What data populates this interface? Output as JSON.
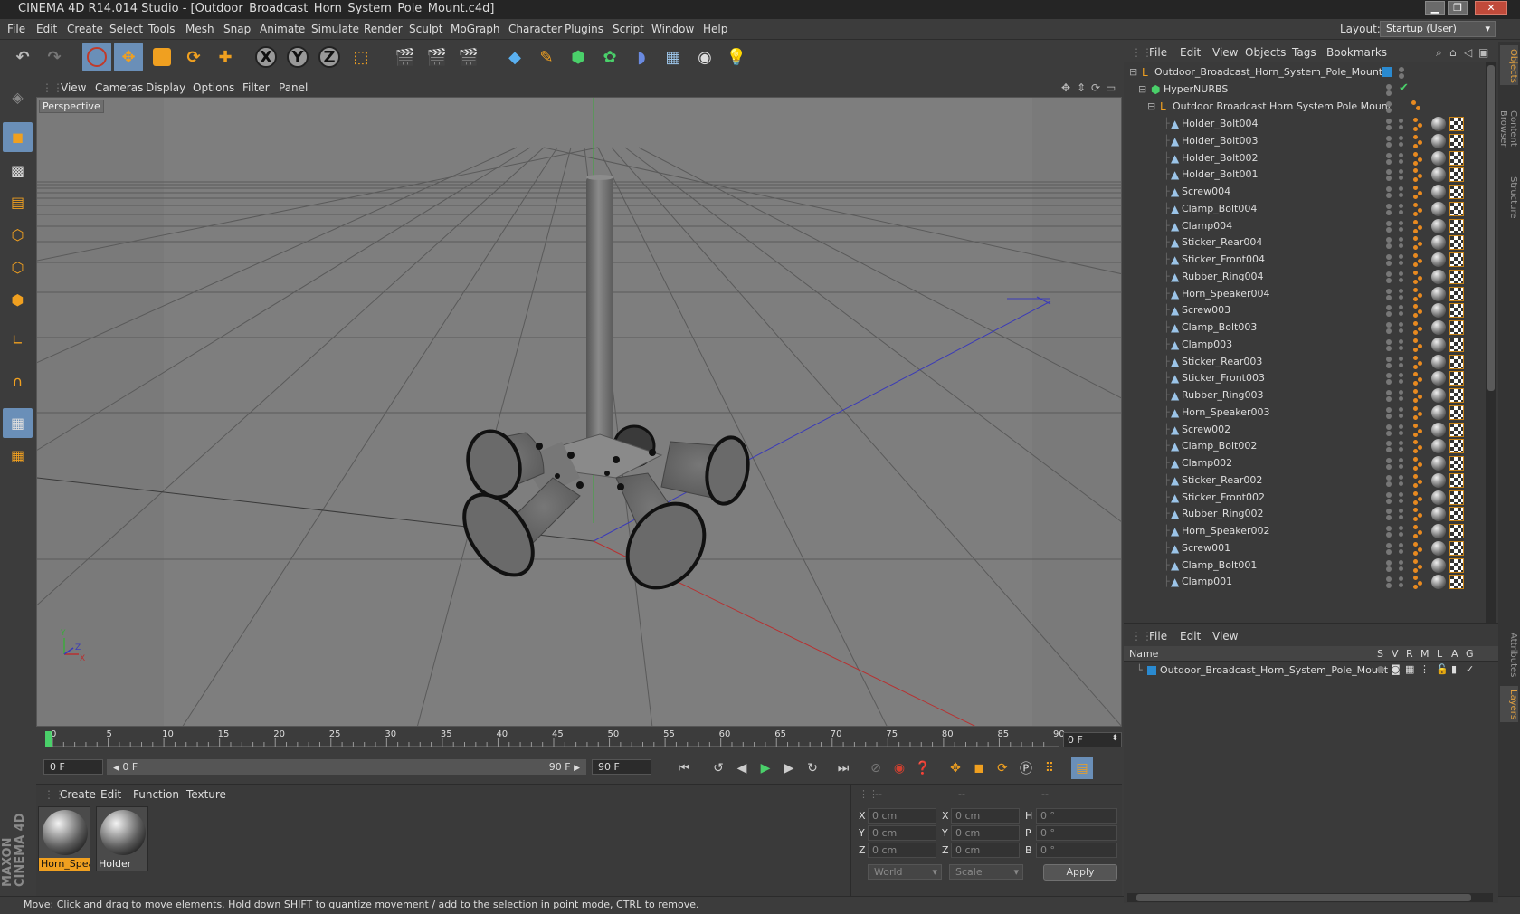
{
  "window": {
    "title": "CINEMA 4D R14.014 Studio - [Outdoor_Broadcast_Horn_System_Pole_Mount.c4d]"
  },
  "menu": [
    "File",
    "Edit",
    "Create",
    "Select",
    "Tools",
    "Mesh",
    "Snap",
    "Animate",
    "Simulate",
    "Render",
    "Sculpt",
    "MoGraph",
    "Character",
    "Plugins",
    "Script",
    "Window",
    "Help"
  ],
  "layout": {
    "label": "Layout:",
    "value": "Startup (User)"
  },
  "viewport": {
    "menu": [
      "View",
      "Cameras",
      "Display",
      "Options",
      "Filter",
      "Panel"
    ],
    "camera_label": "Perspective",
    "axis_labels": {
      "y": "Y",
      "z": "Z",
      "x": "X"
    }
  },
  "timeline": {
    "ticks": [
      "0",
      "5",
      "10",
      "15",
      "20",
      "25",
      "30",
      "35",
      "40",
      "45",
      "50",
      "55",
      "60",
      "65",
      "70",
      "75",
      "80",
      "85",
      "90"
    ],
    "current_frame": "0 F",
    "start_field": "0 F",
    "range_start": "0 F",
    "range_end": "90 F",
    "end_field": "90 F"
  },
  "materials": {
    "menu": [
      "Create",
      "Edit",
      "Function",
      "Texture"
    ],
    "items": [
      {
        "name": "Horn_Spea",
        "selected": true
      },
      {
        "name": "Holder",
        "selected": false
      }
    ]
  },
  "coords": {
    "header": [
      "--",
      "--",
      "--"
    ],
    "pos": {
      "x": "0 cm",
      "y": "0 cm",
      "z": "0 cm"
    },
    "size": {
      "x": "0 cm",
      "y": "0 cm",
      "z": "0 cm"
    },
    "rot": {
      "h": "0 °",
      "p": "0 °",
      "b": "0 °"
    },
    "axis_labels": {
      "x": "X",
      "y": "Y",
      "z": "Z",
      "h": "H",
      "p": "P",
      "b": "B"
    },
    "mode": "World",
    "transform": "Scale",
    "apply": "Apply"
  },
  "status": "Move: Click and drag to move elements. Hold down SHIFT to quantize movement / add to the selection in point mode, CTRL to remove.",
  "objects": {
    "menu": [
      "File",
      "Edit",
      "View",
      "Objects",
      "Tags",
      "Bookmarks"
    ],
    "root": "Outdoor_Broadcast_Horn_System_Pole_Mount",
    "hypernurbs": "HyperNURBS",
    "group": "Outdoor Broadcast Horn System Pole Mount",
    "children": [
      "Holder_Bolt004",
      "Holder_Bolt003",
      "Holder_Bolt002",
      "Holder_Bolt001",
      "Screw004",
      "Clamp_Bolt004",
      "Clamp004",
      "Sticker_Rear004",
      "Sticker_Front004",
      "Rubber_Ring004",
      "Horn_Speaker004",
      "Screw003",
      "Clamp_Bolt003",
      "Clamp003",
      "Sticker_Rear003",
      "Sticker_Front003",
      "Rubber_Ring003",
      "Horn_Speaker003",
      "Screw002",
      "Clamp_Bolt002",
      "Clamp002",
      "Sticker_Rear002",
      "Sticker_Front002",
      "Rubber_Ring002",
      "Horn_Speaker002",
      "Screw001",
      "Clamp_Bolt001",
      "Clamp001"
    ]
  },
  "layers": {
    "menu": [
      "File",
      "Edit",
      "View"
    ],
    "columns": [
      "Name",
      "S",
      "V",
      "R",
      "M",
      "L",
      "A",
      "G"
    ],
    "row": "Outdoor_Broadcast_Horn_System_Pole_Mount"
  },
  "side_tabs": [
    "Objects",
    "Content Browser",
    "Structure",
    "Attributes",
    "Layers"
  ],
  "colors": {
    "accent_blue": "#6a8fb8",
    "accent_orange": "#f0a020",
    "background": "#3c3c3c",
    "viewport": "#7c7c7c"
  }
}
